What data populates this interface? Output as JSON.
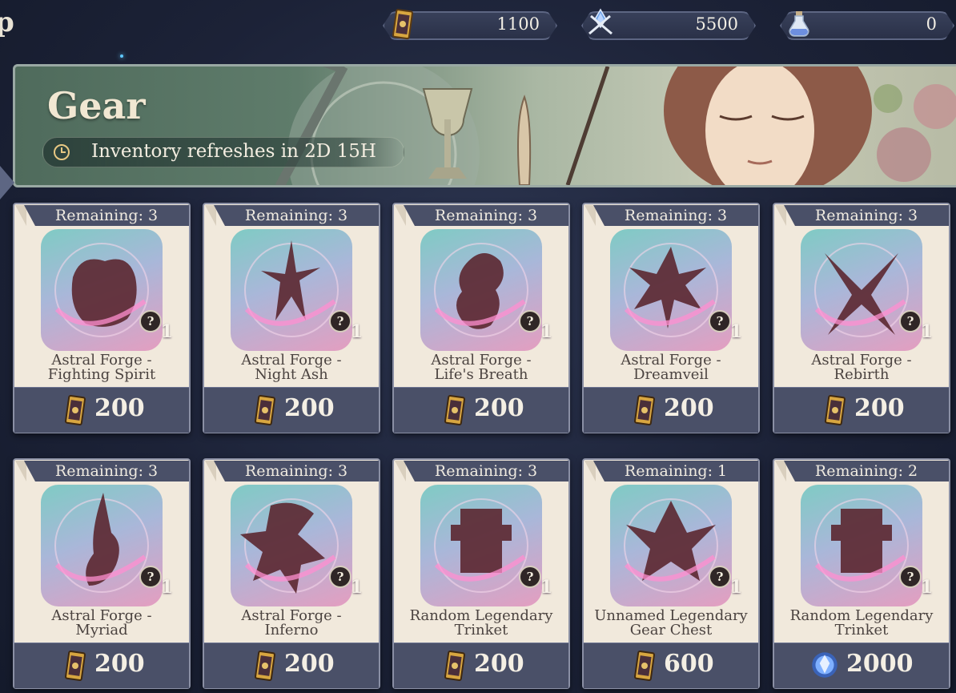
{
  "corner_glyph": "p",
  "currencies": [
    {
      "icon": "gold-ticket-icon",
      "value": "1100"
    },
    {
      "icon": "crystal-swords-icon",
      "value": "5500"
    },
    {
      "icon": "potion-bottle-icon",
      "value": "0"
    }
  ],
  "banner": {
    "title": "Gear",
    "refresh_text": "Inventory refreshes in 2D 15H"
  },
  "remaining_label": "Remaining:",
  "items": [
    {
      "remaining": "3",
      "name1": "Astral Forge -",
      "name2": "Fighting Spirit",
      "qty": "1",
      "price": "200",
      "price_icon": "gold-ticket-icon"
    },
    {
      "remaining": "3",
      "name1": "Astral Forge -",
      "name2": "Night Ash",
      "qty": "1",
      "price": "200",
      "price_icon": "gold-ticket-icon"
    },
    {
      "remaining": "3",
      "name1": "Astral Forge -",
      "name2": "Life's Breath",
      "qty": "1",
      "price": "200",
      "price_icon": "gold-ticket-icon"
    },
    {
      "remaining": "3",
      "name1": "Astral Forge -",
      "name2": "Dreamveil",
      "qty": "1",
      "price": "200",
      "price_icon": "gold-ticket-icon"
    },
    {
      "remaining": "3",
      "name1": "Astral Forge -",
      "name2": "Rebirth",
      "qty": "1",
      "price": "200",
      "price_icon": "gold-ticket-icon"
    },
    {
      "remaining": "3",
      "name1": "Astral Forge -",
      "name2": "Myriad",
      "qty": "1",
      "price": "200",
      "price_icon": "gold-ticket-icon"
    },
    {
      "remaining": "3",
      "name1": "Astral Forge -",
      "name2": "Inferno",
      "qty": "1",
      "price": "200",
      "price_icon": "gold-ticket-icon"
    },
    {
      "remaining": "3",
      "name1": "Random Legendary",
      "name2": "Trinket",
      "qty": "1",
      "price": "200",
      "price_icon": "gold-ticket-icon"
    },
    {
      "remaining": "1",
      "name1": "Unnamed Legendary",
      "name2": "Gear Chest",
      "qty": "1",
      "price": "600",
      "price_icon": "gold-ticket-icon"
    },
    {
      "remaining": "2",
      "name1": "Random Legendary",
      "name2": "Trinket",
      "qty": "1",
      "price": "2000",
      "price_icon": "blue-crystal-icon"
    }
  ],
  "colors": {
    "background": "#1c2237",
    "card_bg": "#f1e9dc",
    "price_bar": "#4a5068",
    "banner_green": "#5f7c6b"
  }
}
